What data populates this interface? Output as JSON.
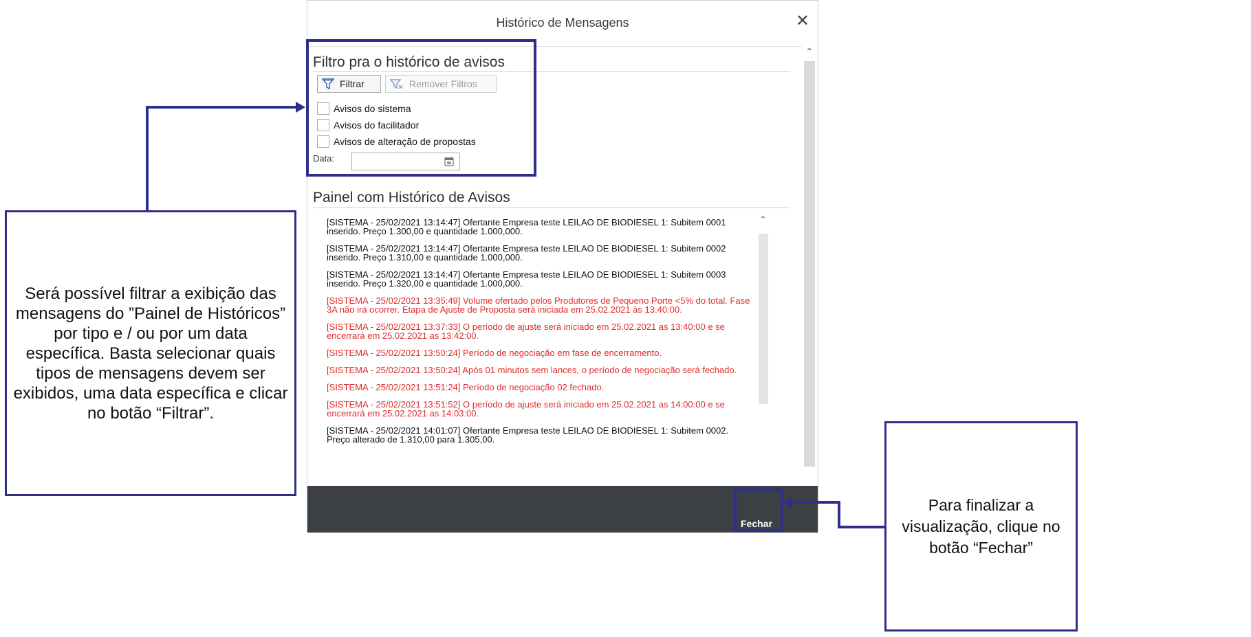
{
  "dialog": {
    "title": "Histórico de Mensagens",
    "close_symbol": "✕"
  },
  "filter": {
    "title": "Filtro pra o histórico de avisos",
    "filter_button": "Filtrar",
    "remove_button": "Remover Filtros",
    "checkboxes": [
      "Avisos do sistema",
      "Avisos do facilitador",
      "Avisos de alteração de propostas"
    ],
    "date_label": "Data:"
  },
  "panel": {
    "title": "Painel com Histórico de Avisos",
    "messages": [
      {
        "color": "black",
        "text": "[SISTEMA - 25/02/2021 13:14:47] Ofertante Empresa teste LEILAO DE BIODIESEL 1: Subitem 0001 inserido. Preço 1.300,00 e quantidade 1.000,000."
      },
      {
        "color": "black",
        "text": "[SISTEMA - 25/02/2021 13:14:47] Ofertante Empresa teste LEILAO DE BIODIESEL 1: Subitem 0002 inserido. Preço 1.310,00 e quantidade 1.000,000."
      },
      {
        "color": "black",
        "text": "[SISTEMA - 25/02/2021 13:14:47] Ofertante Empresa teste LEILAO DE BIODIESEL 1: Subitem 0003 inserido. Preço 1.320,00 e quantidade 1.000,000."
      },
      {
        "color": "red",
        "text": "[SISTEMA - 25/02/2021 13:35:49] Volume ofertado pelos Produtores de Pequeno Porte <5% do total. Fase 3A não irá ocorrer. Etapa de Ajuste de Proposta será iniciada em 25.02.2021 às 13:40:00."
      },
      {
        "color": "red",
        "text": "[SISTEMA - 25/02/2021 13:37:33] O período de ajuste será iniciado em 25.02.2021 as 13:40:00 e se encerrará em 25.02.2021 as 13:42:00."
      },
      {
        "color": "red",
        "text": "[SISTEMA - 25/02/2021 13:50:24] Período de negociação em fase de encerramento."
      },
      {
        "color": "red",
        "text": "[SISTEMA - 25/02/2021 13:50:24] Após 01 minutos sem lances, o período de negociação será fechado."
      },
      {
        "color": "red",
        "text": "[SISTEMA - 25/02/2021 13:51:24] Período de negociação 02 fechado."
      },
      {
        "color": "red",
        "text": "[SISTEMA - 25/02/2021 13:51:52] O período de ajuste será iniciado em 25.02.2021 as 14:00:00 e se encerrará em 25.02.2021 as 14:03:00."
      },
      {
        "color": "black",
        "text": "[SISTEMA - 25/02/2021 14:01:07] Ofertante Empresa teste LEILAO DE BIODIESEL 1: Subitem 0002. Preço alterado de 1.310,00 para 1.305,00."
      }
    ]
  },
  "footer": {
    "close_button": "Fechar"
  },
  "annotations": {
    "left_callout": "Será possível filtrar a exibição das mensagens do ”Painel de Históricos” por tipo e / ou por um data específica. Basta selecionar quais tipos de mensagens devem ser exibidos, uma data específica e clicar no botão “Filtrar”.",
    "right_callout": "Para finalizar a visualização, clique no botão “Fechar”"
  },
  "colors": {
    "annotation_blue": "#2f2e8c",
    "red_message": "#e02b2b",
    "footer_bg": "#3c3f44"
  }
}
